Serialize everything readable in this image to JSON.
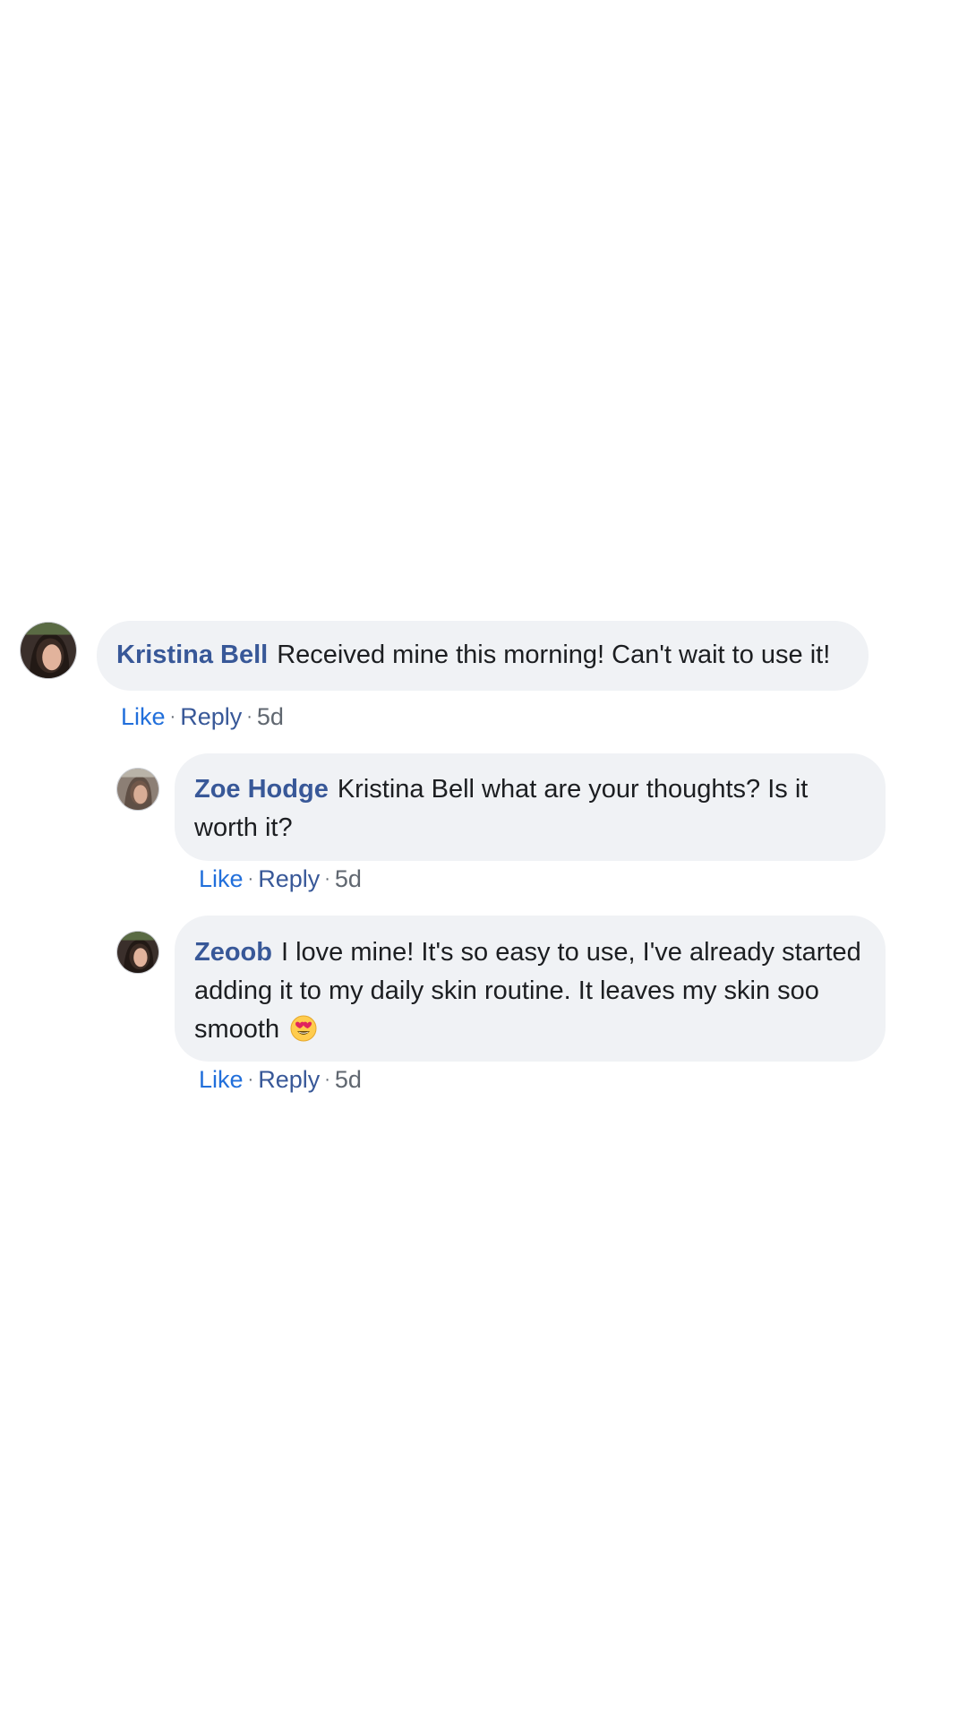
{
  "comments": [
    {
      "author": "Kristina Bell",
      "text": "Received mine this morning! Can't wait to use it!",
      "like": "Like",
      "reply": "Reply",
      "separator": "·",
      "time": "5d"
    }
  ],
  "replies": [
    {
      "author": "Zoe Hodge",
      "text": "Kristina Bell what are your thoughts? Is it worth it?",
      "like": "Like",
      "reply": "Reply",
      "separator": "·",
      "time": "5d"
    },
    {
      "author": "Zeoob",
      "text": "I love mine! It's so easy to use, I've already started adding it to my daily skin routine. It leaves my skin soo smooth",
      "emoji": "heart-eyes-emoji",
      "like": "Like",
      "reply": "Reply",
      "separator": "·",
      "time": "5d"
    }
  ],
  "colors": {
    "author": "#385898",
    "like": "#216fdb",
    "bubble": "#f0f2f5",
    "meta": "#606770"
  }
}
